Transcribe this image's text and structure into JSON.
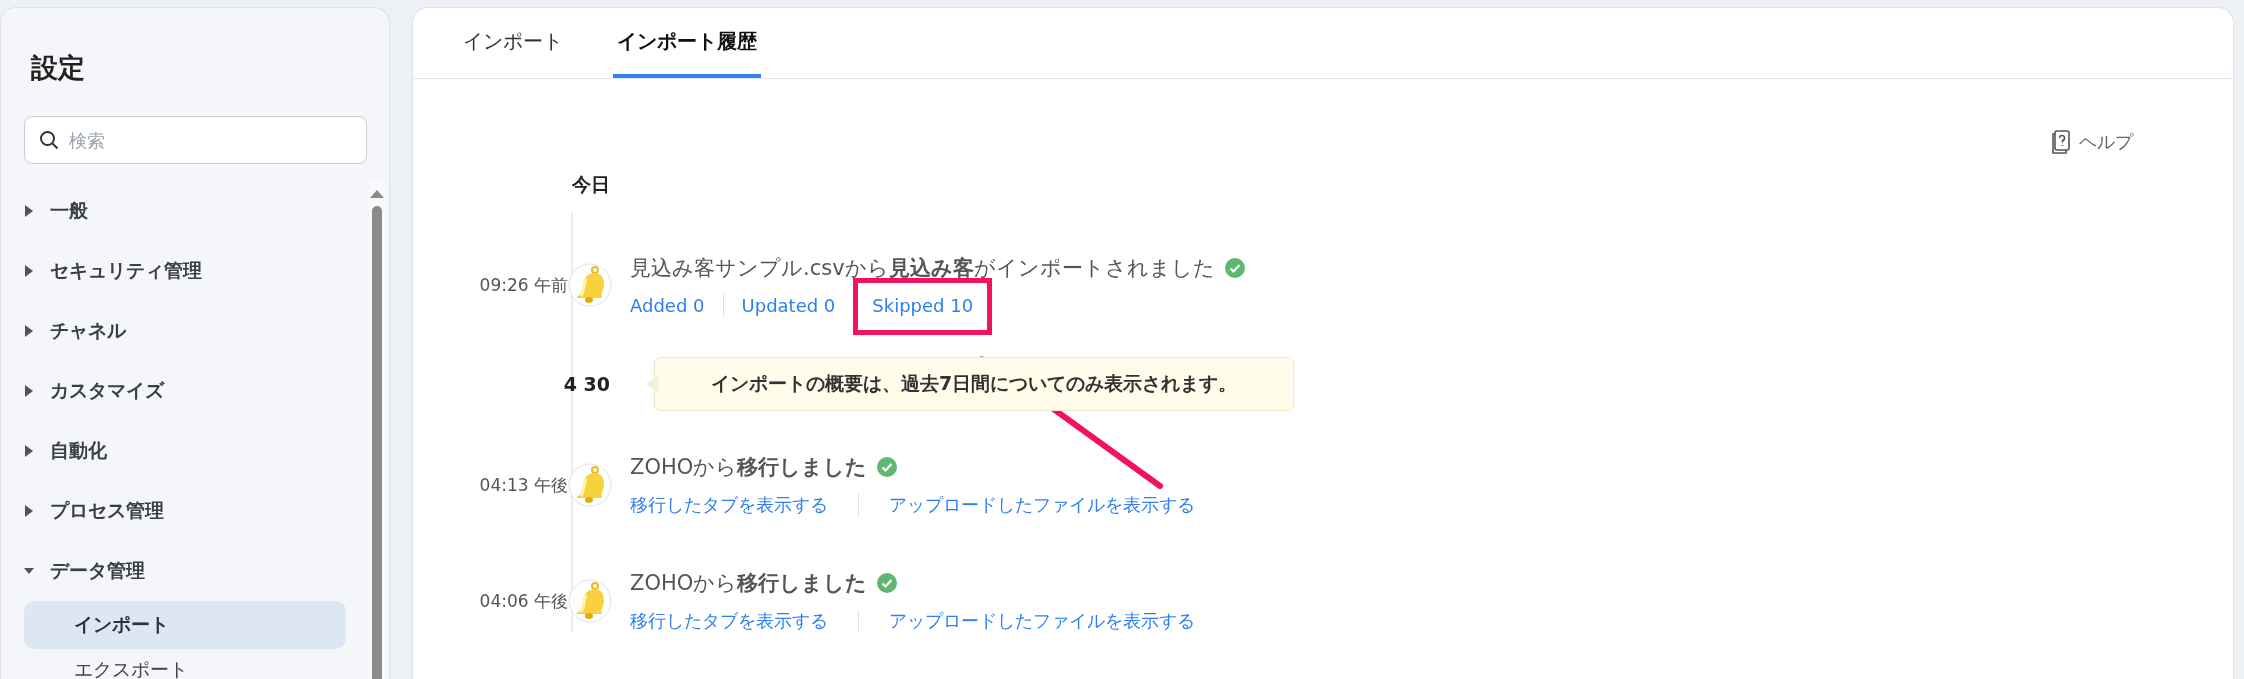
{
  "sidebar": {
    "title": "設定",
    "search": {
      "placeholder": "検索"
    },
    "items": [
      {
        "label": "一般",
        "expanded": false
      },
      {
        "label": "セキュリティ管理",
        "expanded": false
      },
      {
        "label": "チャネル",
        "expanded": false
      },
      {
        "label": "カスタマイズ",
        "expanded": false
      },
      {
        "label": "自動化",
        "expanded": false
      },
      {
        "label": "プロセス管理",
        "expanded": false
      },
      {
        "label": "データ管理",
        "expanded": true,
        "children": [
          {
            "label": "インポート",
            "selected": true
          },
          {
            "label": "エクスポート",
            "selected": false
          }
        ]
      }
    ]
  },
  "tabs": [
    {
      "label": "インポート",
      "selected": false
    },
    {
      "label": "インポート履歴",
      "selected": true
    }
  ],
  "help": "ヘルプ",
  "timeline": [
    {
      "date": "今日",
      "entries": [
        {
          "time": "09:26 午前",
          "message": "見込み客サンプル.csvから**見込み客**がインポートされました",
          "success": true,
          "links": [
            {
              "label": "Added 0",
              "highlighted": false
            },
            {
              "label": "Updated 0",
              "highlighted": false
            },
            {
              "label": "Skipped 10",
              "highlighted": true
            }
          ]
        }
      ]
    },
    {
      "date": "4 30",
      "notice": "インポートの概要は、過去7日間についてのみ表示されます。",
      "entries": [
        {
          "time": "04:13 午後",
          "message": "ZOHOから**移行しました**",
          "success": true,
          "links": [
            {
              "label": "移行したタブを表示する",
              "highlighted": false
            },
            {
              "label": "アップロードしたファイルを表示する",
              "highlighted": false
            }
          ]
        },
        {
          "time": "04:06 午後",
          "message": "ZOHOから**移行しました**",
          "success": true,
          "links": [
            {
              "label": "移行したタブを表示する",
              "highlighted": false
            },
            {
              "label": "アップロードしたファイルを表示する",
              "highlighted": false
            }
          ]
        }
      ]
    }
  ]
}
